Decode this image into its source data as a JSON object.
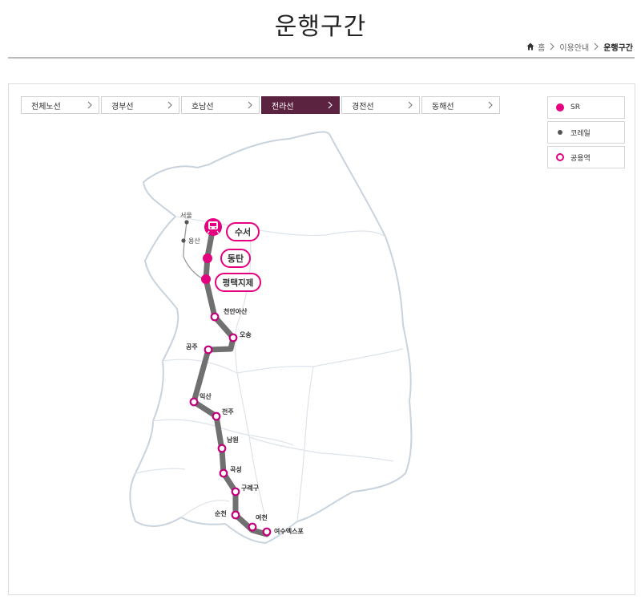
{
  "header": {
    "title": "운행구간",
    "breadcrumb": [
      "홈",
      "이용안내",
      "운행구간"
    ]
  },
  "tabs": [
    {
      "label": "전체노선",
      "active": false
    },
    {
      "label": "경부선",
      "active": false
    },
    {
      "label": "호남선",
      "active": false
    },
    {
      "label": "전라선",
      "active": true
    },
    {
      "label": "경전선",
      "active": false
    },
    {
      "label": "동해선",
      "active": false
    }
  ],
  "legend": [
    {
      "label": "SR",
      "type": "sr"
    },
    {
      "label": "코레일",
      "type": "korail"
    },
    {
      "label": "공용역",
      "type": "shared"
    }
  ],
  "colors": {
    "accent": "#e4007f",
    "active_tab": "#5b2340",
    "route": "#707070",
    "korail": "#555555",
    "map_outline": "#c9d3dd"
  },
  "map": {
    "korail_origin": [
      "서울",
      "용산"
    ],
    "sr_stations": [
      "수서",
      "동탄",
      "평택지제"
    ],
    "shared_stations": [
      "천안아산",
      "오송",
      "공주",
      "익산",
      "전주",
      "남원",
      "곡성",
      "구례구",
      "순천",
      "여천",
      "여수엑스포"
    ]
  }
}
